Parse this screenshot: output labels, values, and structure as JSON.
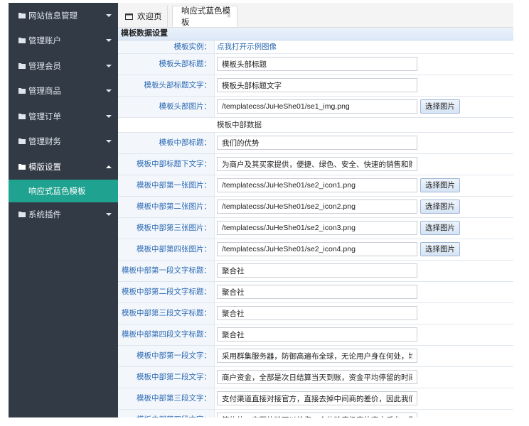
{
  "sidebar": {
    "items": [
      {
        "label": "网站信息管理"
      },
      {
        "label": "管理账户"
      },
      {
        "label": "管理会员"
      },
      {
        "label": "管理商品"
      },
      {
        "label": "管理订单"
      },
      {
        "label": "管理财务"
      },
      {
        "label": "模版设置"
      },
      {
        "label": "系统插件"
      }
    ],
    "active_sub": "响应式蓝色模板"
  },
  "tabs": {
    "home": "欢迎页",
    "active": "响应式蓝色模板",
    "close": "×"
  },
  "form": {
    "section_title": "模板数据设置",
    "example_label": "模板实例：",
    "example_link": "点我打开示例图像",
    "subhead": "模板中部数据",
    "choose_button": "选择图片",
    "rows": [
      {
        "label": "模板头部标题：",
        "value": "模板头部标题"
      },
      {
        "label": "模板头部标题文字：",
        "value": "模板头部标题文字"
      },
      {
        "label": "模板头部图片：",
        "value": "/templatecss/JuHeShe01/se1_img.png"
      },
      {
        "label": "模板中部标题：",
        "value": "我们的优势"
      },
      {
        "label": "模板中部标题下文字：",
        "value": "为商户及其买家提供，便捷、绿色、安全、快速的销售和购买体验"
      },
      {
        "label": "模板中部第一张图片：",
        "value": "/templatecss/JuHeShe01/se2_icon1.png"
      },
      {
        "label": "模板中部第二张图片：",
        "value": "/templatecss/JuHeShe01/se2_icon2.png"
      },
      {
        "label": "模板中部第三张图片：",
        "value": "/templatecss/JuHeShe01/se2_icon3.png"
      },
      {
        "label": "模板中部第四张图片：",
        "value": "/templatecss/JuHeShe01/se2_icon4.png"
      },
      {
        "label": "模板中部第一段文字标题：",
        "value": "聚合社"
      },
      {
        "label": "模板中部第二段文字标题：",
        "value": "聚合社"
      },
      {
        "label": "模板中部第三段文字标题：",
        "value": "聚合社"
      },
      {
        "label": "模板中部第四段文字标题：",
        "value": "聚合社"
      },
      {
        "label": "模板中部第一段文字：",
        "value": "采用群集服务器，防御高遍布全球，无论用户身在何处，均能获得"
      },
      {
        "label": "模板中部第二段文字：",
        "value": "商户资金，全部是次日结算当天到账，资金平均停留的时间不超过"
      },
      {
        "label": "模板中部第三段文字：",
        "value": "支付渠道直接对接官方，直接去掉中间商的差价，因此我们可以给"
      },
      {
        "label": "模板中部第四段文字：",
        "value": "简约的UI交互体验可以给您一个体验度极高的商户后台，更好的下"
      }
    ]
  },
  "colors": {
    "sidebar_bg": "#323a45",
    "sidebar_active_sub": "#1fa28f",
    "label_text": "#2a68b2"
  }
}
